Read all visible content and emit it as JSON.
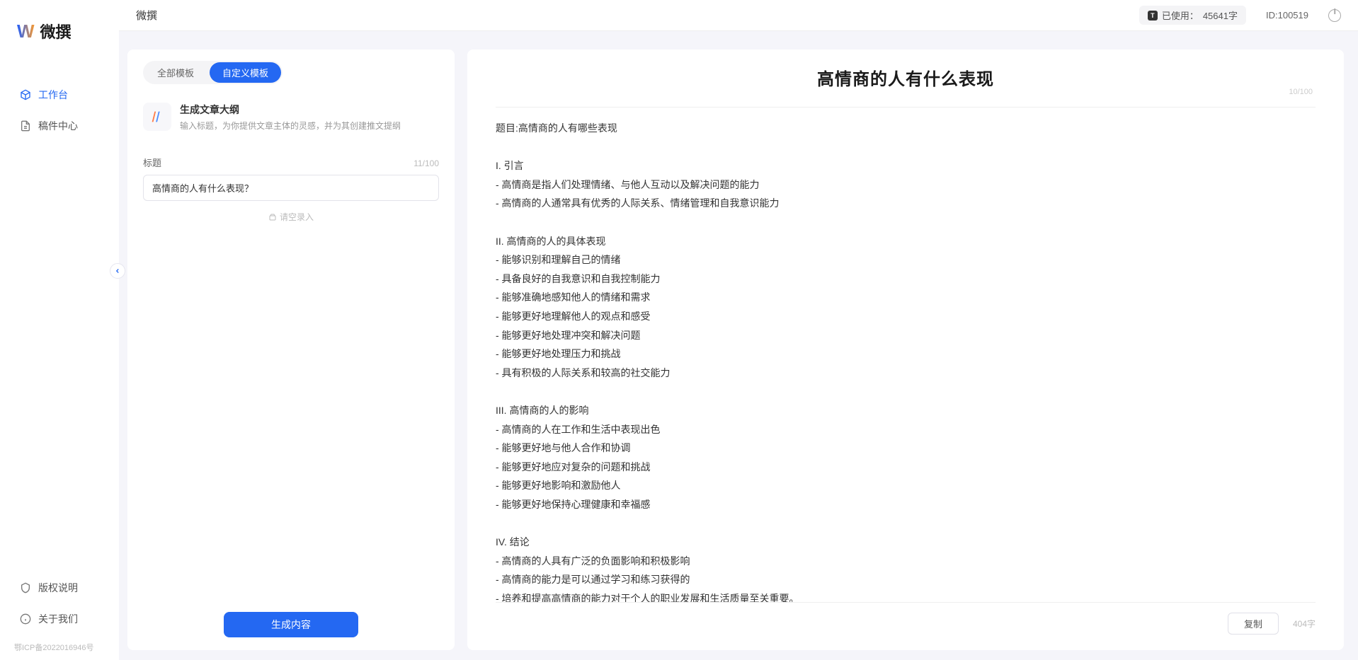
{
  "brand": {
    "name": "微撰",
    "logo_text": "微撰"
  },
  "top": {
    "usage_label": "已使用：",
    "usage_value": "45641字",
    "user_id_label": "ID:",
    "user_id": "100519"
  },
  "sidebar": {
    "items": [
      {
        "label": "工作台",
        "icon": "cube"
      },
      {
        "label": "稿件中心",
        "icon": "doc"
      }
    ],
    "footer": [
      {
        "label": "版权说明",
        "icon": "shield"
      },
      {
        "label": "关于我们",
        "icon": "info"
      }
    ],
    "icp": "鄂ICP备2022016946号"
  },
  "left": {
    "tabs": [
      {
        "label": "全部模板",
        "active": false
      },
      {
        "label": "自定义模板",
        "active": true
      }
    ],
    "template": {
      "title": "生成文章大纲",
      "desc": "输入标题，为你提供文章主体的灵感，并为其创建推文提纲"
    },
    "field_label": "标题",
    "title_value": "高情商的人有什么表现？",
    "title_count": "11/100",
    "hint": "请空录入",
    "generate": "生成内容"
  },
  "right": {
    "title": "高情商的人有什么表现",
    "title_count": "10/100",
    "body": "题目:高情商的人有哪些表现\n\nI. 引言\n- 高情商是指人们处理情绪、与他人互动以及解决问题的能力\n- 高情商的人通常具有优秀的人际关系、情绪管理和自我意识能力\n\nII. 高情商的人的具体表现\n- 能够识别和理解自己的情绪\n- 具备良好的自我意识和自我控制能力\n- 能够准确地感知他人的情绪和需求\n- 能够更好地理解他人的观点和感受\n- 能够更好地处理冲突和解决问题\n- 能够更好地处理压力和挑战\n- 具有积极的人际关系和较高的社交能力\n\nIII. 高情商的人的影响\n- 高情商的人在工作和生活中表现出色\n- 能够更好地与他人合作和协调\n- 能够更好地应对复杂的问题和挑战\n- 能够更好地影响和激励他人\n- 能够更好地保持心理健康和幸福感\n\nIV. 结论\n- 高情商的人具有广泛的负面影响和积极影响\n- 高情商的能力是可以通过学习和练习获得的\n- 培养和提高高情商的能力对于个人的职业发展和生活质量至关重要。",
    "copy": "复制",
    "word_count": "404字"
  }
}
